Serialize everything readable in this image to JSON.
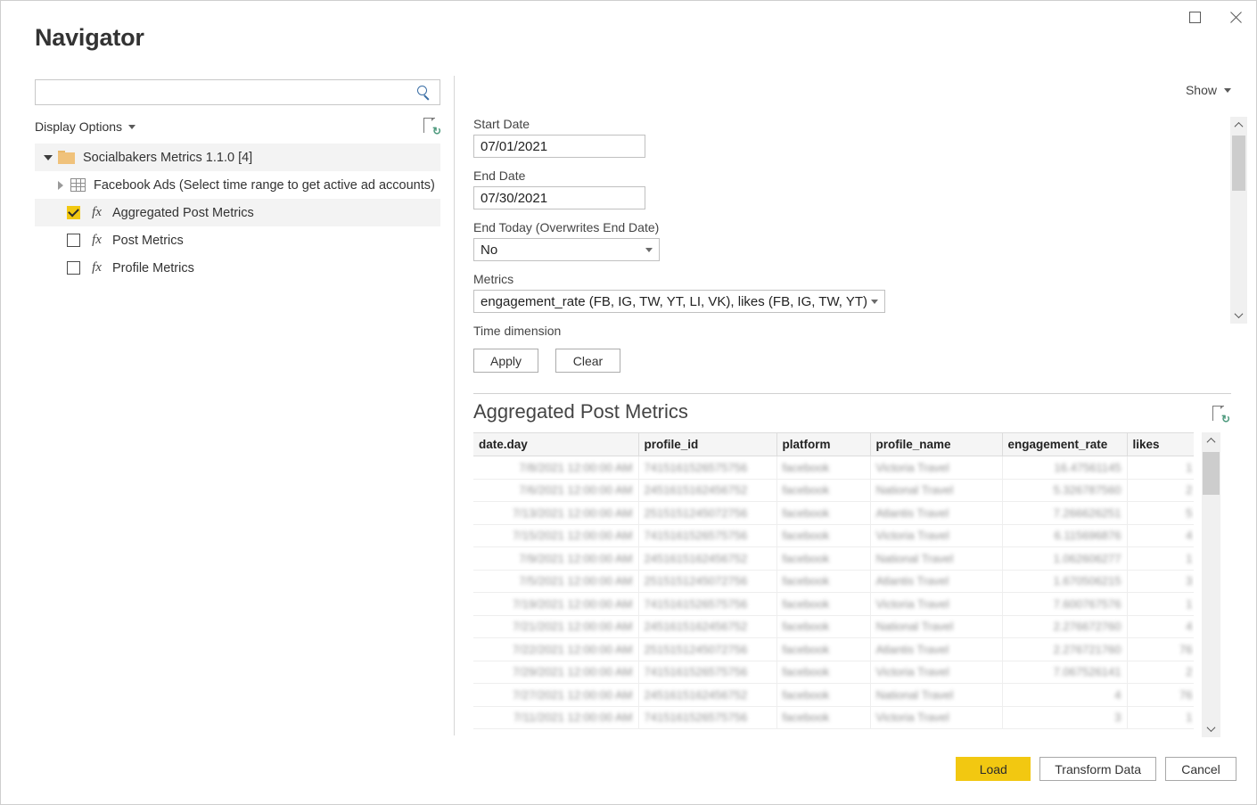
{
  "window": {
    "title": "Navigator",
    "maximize_label": "Maximize",
    "close_label": "Close"
  },
  "search": {
    "value": "",
    "placeholder": ""
  },
  "left_pane": {
    "display_options_label": "Display Options",
    "refresh_icon_title": "Refresh preview",
    "tree": [
      {
        "label": "Socialbakers Metrics 1.1.0 [4]",
        "icon": "folder-icon",
        "expander": "triangle-down",
        "level": 0,
        "selected": false
      },
      {
        "label": "Facebook Ads (Select time range to get active ad accounts)",
        "icon": "grid-icon",
        "expander": "triangle-right",
        "level": 1,
        "selected": false
      },
      {
        "label": "Aggregated Post Metrics",
        "icon": "fx-icon",
        "checked": true,
        "level": 2,
        "selected": true
      },
      {
        "label": "Post Metrics",
        "icon": "fx-icon",
        "checked": false,
        "level": 2,
        "selected": false
      },
      {
        "label": "Profile Metrics",
        "icon": "fx-icon",
        "checked": false,
        "level": 2,
        "selected": false
      }
    ]
  },
  "right_pane": {
    "show_label": "Show",
    "parameters": {
      "start_date": {
        "label": "Start Date",
        "value": "07/01/2021"
      },
      "end_date": {
        "label": "End Date",
        "value": "07/30/2021"
      },
      "end_today": {
        "label": "End Today (Overwrites End Date)",
        "value": "No"
      },
      "metrics": {
        "label": "Metrics",
        "value": "engagement_rate (FB, IG, TW, YT, LI, VK), likes (FB, IG, TW, YT)"
      },
      "time_dimension": {
        "label": "Time dimension",
        "value": ""
      }
    },
    "apply_label": "Apply",
    "clear_label": "Clear",
    "preview": {
      "title": "Aggregated Post Metrics",
      "refresh_icon_title": "Refresh preview",
      "columns": [
        "date.day",
        "profile_id",
        "platform",
        "profile_name",
        "engagement_rate",
        "likes"
      ],
      "rows": [
        [
          "7/8/2021 12:00:00 AM",
          "7415161526575756",
          "facebook",
          "Victoria Travel",
          "16.47561145",
          "1"
        ],
        [
          "7/6/2021 12:00:00 AM",
          "2451615162456752",
          "facebook",
          "National Travel",
          "5.326787560",
          "2"
        ],
        [
          "7/13/2021 12:00:00 AM",
          "2515151245072756",
          "facebook",
          "Atlantis Travel",
          "7.266626251",
          "5"
        ],
        [
          "7/15/2021 12:00:00 AM",
          "7415161526575756",
          "facebook",
          "Victoria Travel",
          "6.115696876",
          "4"
        ],
        [
          "7/9/2021 12:00:00 AM",
          "2451615162456752",
          "facebook",
          "National Travel",
          "1.062606277",
          "1"
        ],
        [
          "7/5/2021 12:00:00 AM",
          "2515151245072756",
          "facebook",
          "Atlantis Travel",
          "1.670506215",
          "3"
        ],
        [
          "7/19/2021 12:00:00 AM",
          "7415161526575756",
          "facebook",
          "Victoria Travel",
          "7.600767576",
          "1"
        ],
        [
          "7/21/2021 12:00:00 AM",
          "2451615162456752",
          "facebook",
          "National Travel",
          "2.276672760",
          "4"
        ],
        [
          "7/22/2021 12:00:00 AM",
          "2515151245072756",
          "facebook",
          "Atlantis Travel",
          "2.276721760",
          "76"
        ],
        [
          "7/29/2021 12:00:00 AM",
          "7415161526575756",
          "facebook",
          "Victoria Travel",
          "7.067526141",
          "2"
        ],
        [
          "7/27/2021 12:00:00 AM",
          "2451615162456752",
          "facebook",
          "National Travel",
          "4",
          "76"
        ],
        [
          "7/11/2021 12:00:00 AM",
          "7415161526575756",
          "facebook",
          "Victoria Travel",
          "3",
          "1"
        ]
      ]
    }
  },
  "footer": {
    "load_label": "Load",
    "transform_label": "Transform Data",
    "cancel_label": "Cancel"
  },
  "colors": {
    "accent_yellow": "#f2c811",
    "search_blue": "#3a6ea5",
    "refresh_green": "#4e9a7e",
    "folder_orange": "#f0c27b"
  }
}
